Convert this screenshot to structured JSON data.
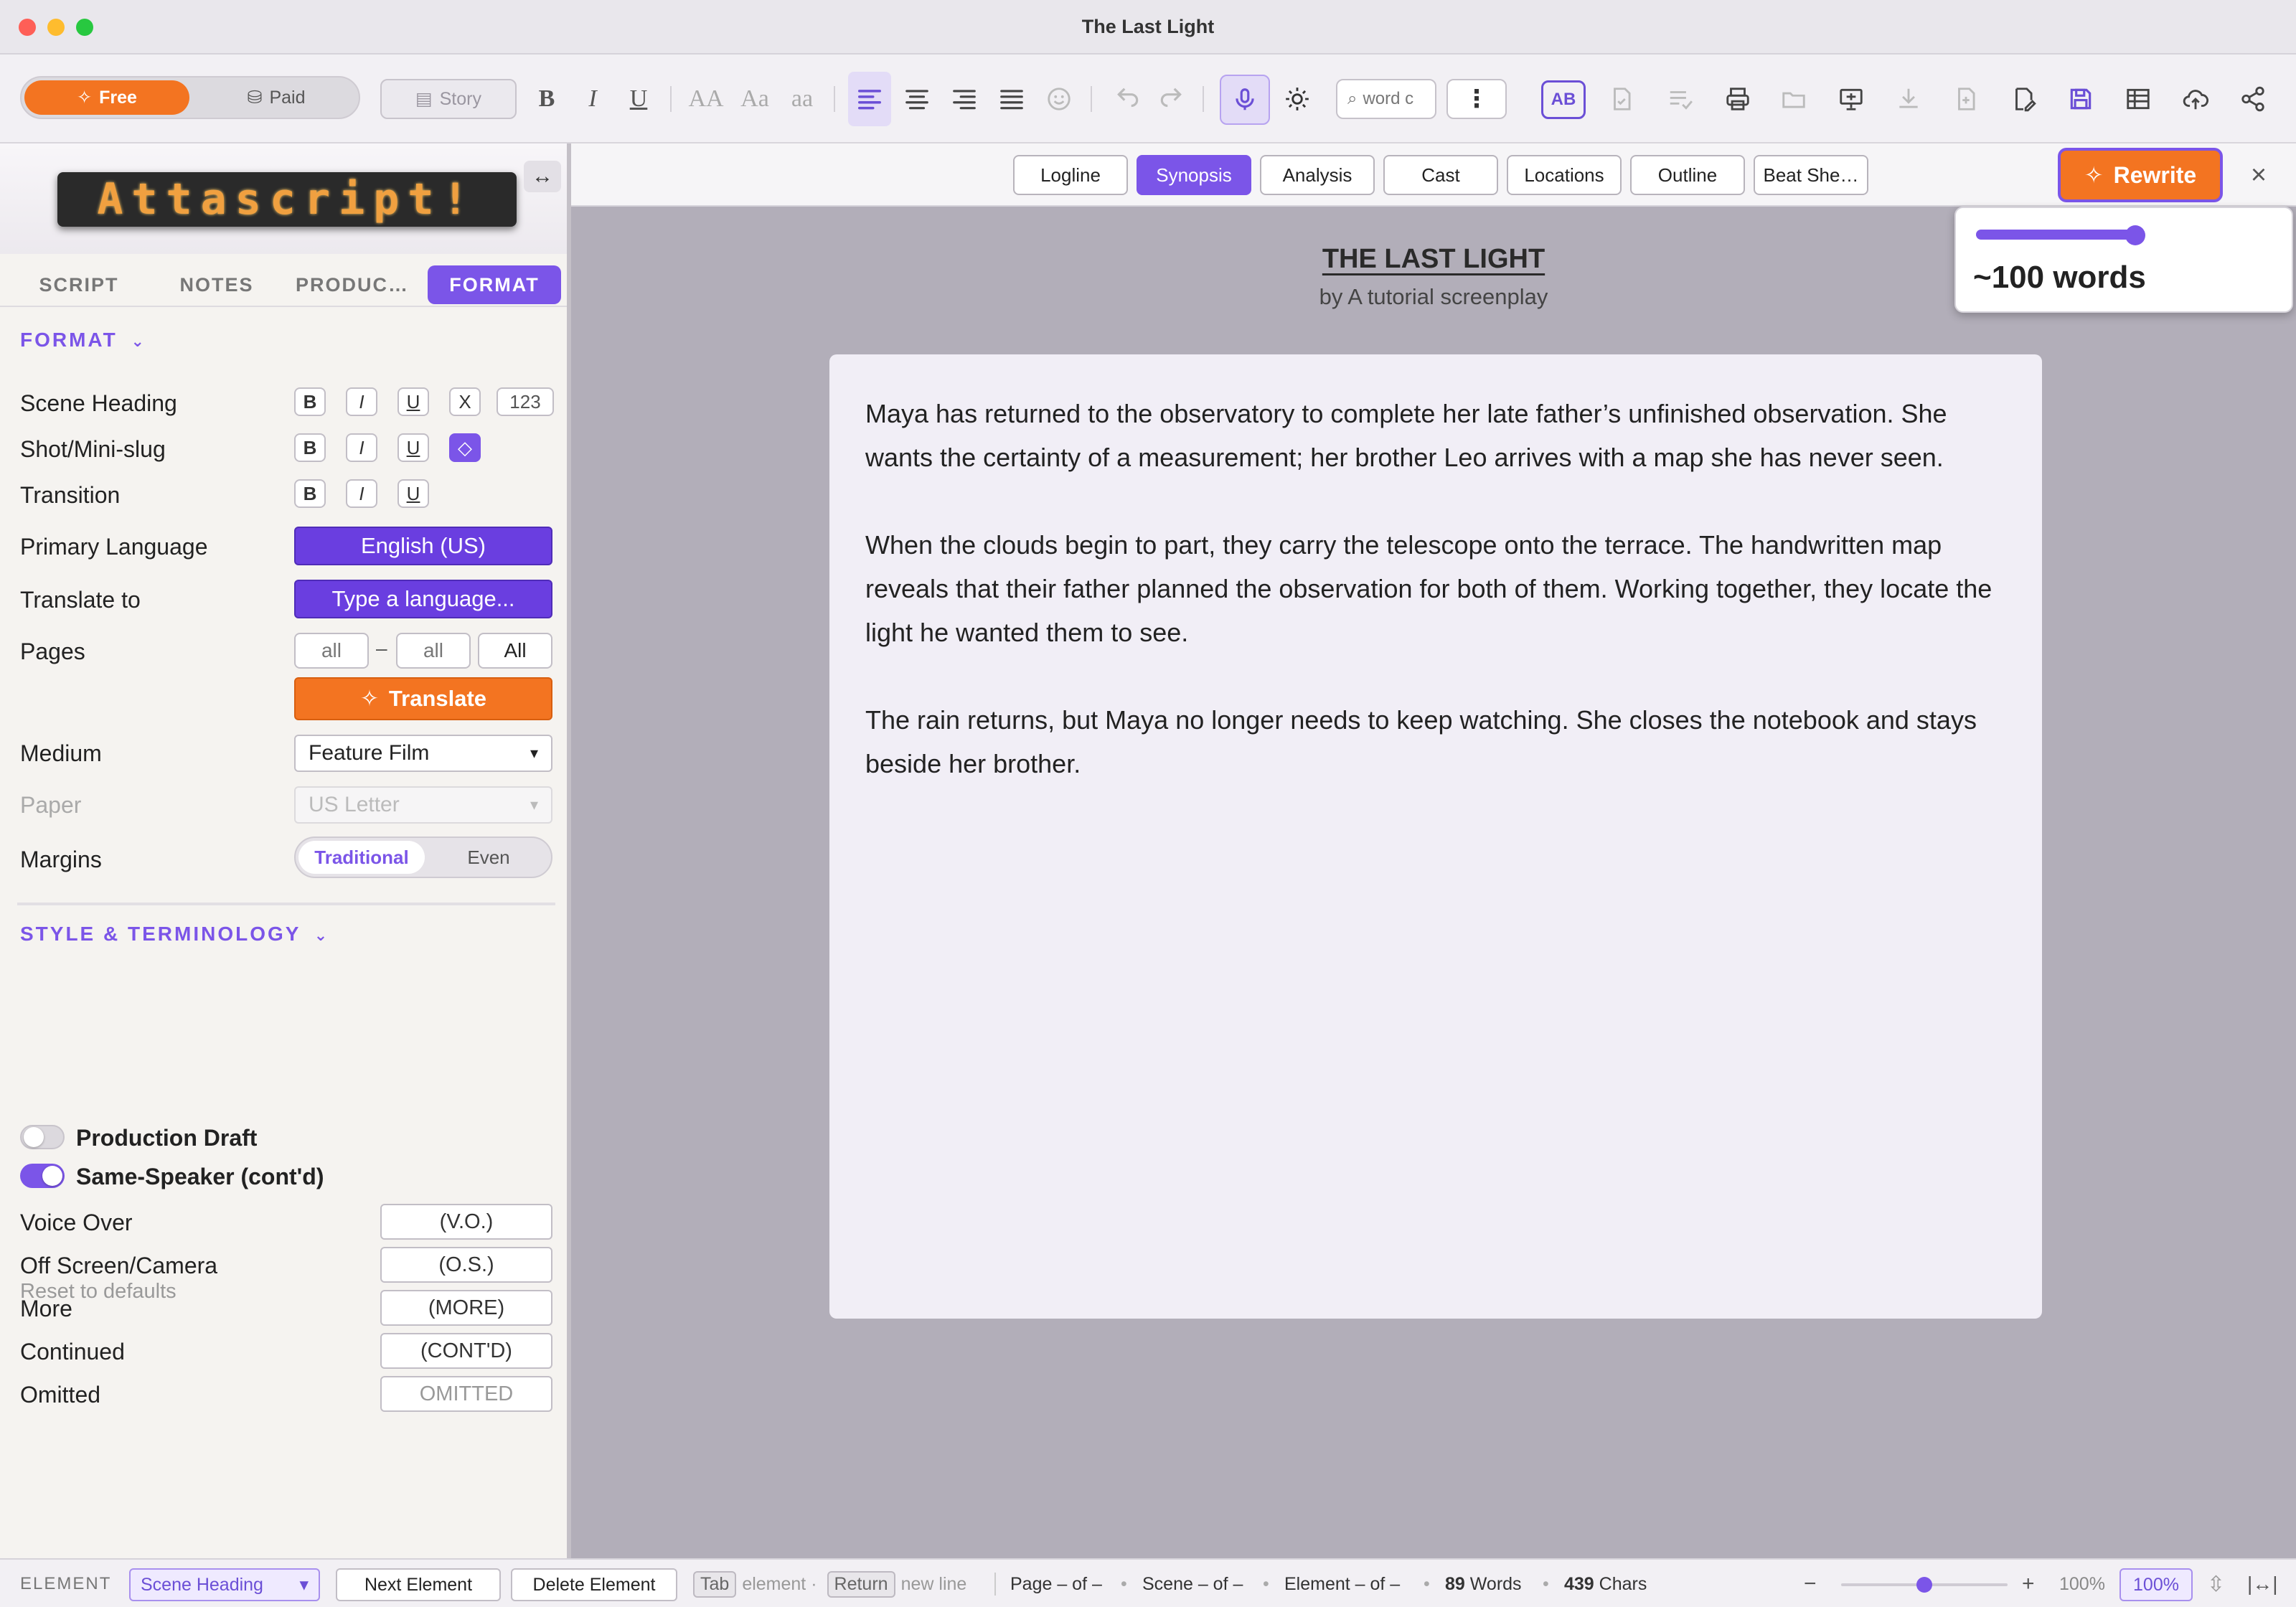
{
  "window": {
    "title": "The Last Light"
  },
  "toolbar": {
    "plan_free": "Free",
    "plan_paid": "Paid",
    "story_label": "Story",
    "font_sizes": [
      "AA",
      "Aa",
      "aa"
    ],
    "search_placeholder": "word c",
    "more_label": "⋮",
    "ab_label": "AB"
  },
  "left_panel": {
    "logo_text": "Attascript!",
    "tabs": [
      "SCRIPT",
      "NOTES",
      "PRODUC…",
      "FORMAT"
    ],
    "active_tab": "FORMAT",
    "format": {
      "header": "FORMAT",
      "rows": {
        "scene_heading": "Scene Heading",
        "shot": "Shot/Mini-slug",
        "transition": "Transition",
        "primary_language": "Primary Language",
        "translate_to": "Translate to",
        "pages": "Pages",
        "medium": "Medium",
        "paper": "Paper",
        "margins": "Margins"
      },
      "bold": "B",
      "italic": "I",
      "underline": "U",
      "caps": "X",
      "numbering": "123",
      "primary_language_value": "English (US)",
      "translate_to_placeholder": "Type a language...",
      "pages_from": "all",
      "pages_dash": "–",
      "pages_to": "all",
      "pages_all_button": "All",
      "translate_button": "Translate",
      "medium_value": "Feature Film",
      "paper_value": "US Letter",
      "margins_options": [
        "Traditional",
        "Even"
      ],
      "margins_selected": "Traditional"
    },
    "style": {
      "header": "STYLE & TERMINOLOGY",
      "production_draft": {
        "label": "Production Draft",
        "on": false
      },
      "same_speaker": {
        "label": "Same-Speaker (cont'd)",
        "on": true
      },
      "terms": [
        {
          "label": "Voice Over",
          "value": "(V.O.)"
        },
        {
          "label": "Off Screen/Camera",
          "value": "(O.S.)"
        },
        {
          "label": "More",
          "value": "(MORE)"
        },
        {
          "label": "Continued",
          "value": "(CONT'D)"
        },
        {
          "label": "Omitted",
          "value": "OMITTED"
        }
      ],
      "reset_label": "Reset to defaults"
    }
  },
  "doc_tabs": {
    "tabs": [
      "Logline",
      "Synopsis",
      "Analysis",
      "Cast",
      "Locations",
      "Outline",
      "Beat She…"
    ],
    "active": "Synopsis",
    "rewrite_label": "Rewrite",
    "close_label": "×"
  },
  "document": {
    "title": "THE LAST LIGHT",
    "byline": "by A tutorial screenplay",
    "paragraphs": [
      "Maya has returned to the observatory to complete her late father’s unfinished observation. She wants the certainty of a measurement; her brother Leo arrives with a map she has never seen.",
      "When the clouds begin to part, they carry the telescope onto the terrace. The handwritten map reveals that their father planned the observation for both of them. Working together, they locate the light he wanted them to see.",
      "The rain returns, but Maya no longer needs to keep watching. She closes the notebook and stays beside her brother."
    ]
  },
  "length_popover": {
    "label": "~100 words",
    "slider_fraction": 0.85
  },
  "statusbar": {
    "element_label": "ELEMENT",
    "element_value": "Scene Heading",
    "next_element": "Next Element",
    "delete_element": "Delete Element",
    "tab_key": "Tab",
    "tab_hint": "element ·",
    "return_key": "Return",
    "return_hint": "new line",
    "page_info": "Page – of –",
    "scene_info": "Scene – of –",
    "element_info": "Element – of –",
    "words_count": "89",
    "words_label": "Words",
    "chars_count": "439",
    "chars_label": "Chars",
    "zoom_minus": "−",
    "zoom_plus": "+",
    "zoom_text": "100%",
    "zoom_badge": "100%",
    "zoom_fraction": 0.5
  },
  "colors": {
    "accent_purple": "#7b55e8",
    "accent_orange": "#f37421",
    "field_purple": "#6a3ee0",
    "canvas_gray": "#b2aeb9"
  },
  "icons": [
    "sparkle-icon",
    "coins-icon",
    "book-icon",
    "bold-icon",
    "italic-icon",
    "underline-icon",
    "align-left-icon",
    "align-center-icon",
    "align-right-icon",
    "justify-icon",
    "emoji-icon",
    "undo-icon",
    "redo-icon",
    "microphone-icon",
    "brightness-icon",
    "search-icon",
    "spellcheck-icon",
    "doc-check-icon",
    "checklist-icon",
    "print-icon",
    "folder-icon",
    "presentation-icon",
    "download-icon",
    "new-doc-icon",
    "edit-doc-icon",
    "save-icon",
    "table-icon",
    "cloud-upload-icon",
    "share-icon",
    "swap-icon",
    "chevron-down-icon",
    "close-icon",
    "fit-height-icon",
    "fit-width-icon"
  ]
}
